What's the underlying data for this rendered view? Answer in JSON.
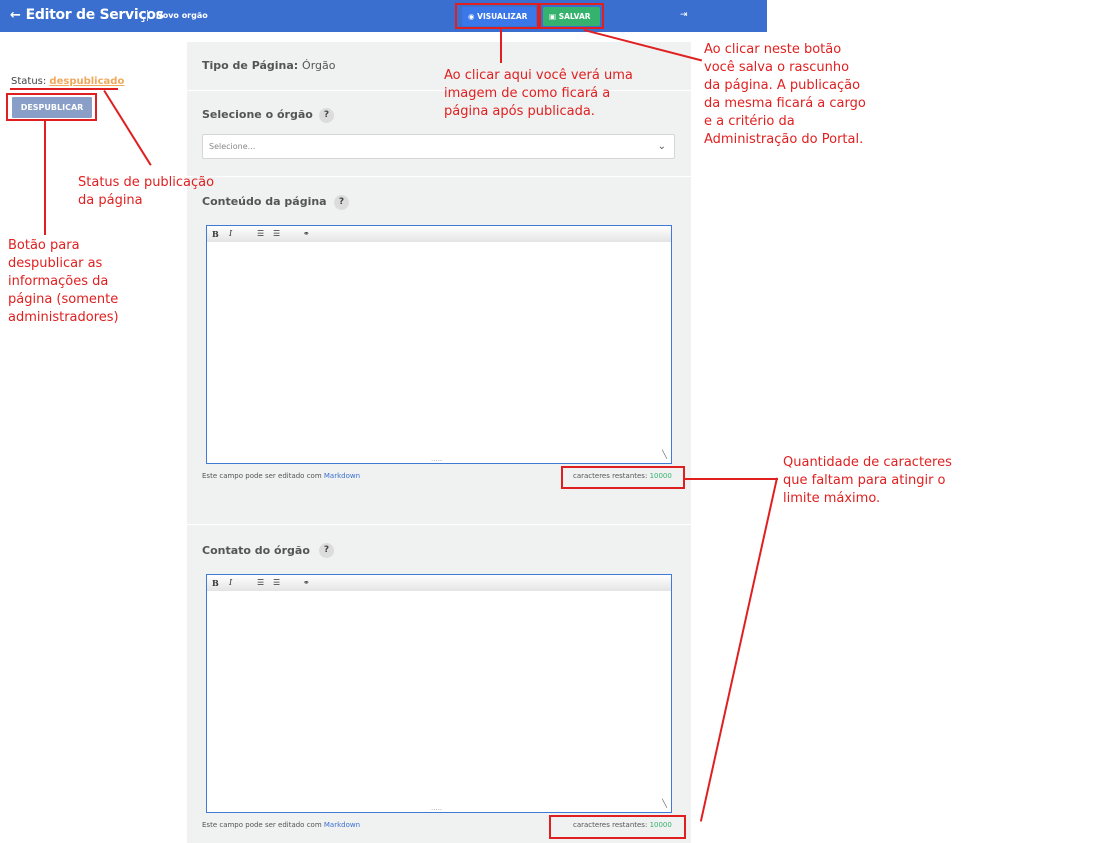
{
  "topbar": {
    "back_arrow": "🡐",
    "title": "Editor de Serviços",
    "breadcrumb": "Novo orgão",
    "visualize_label": "VISUALIZAR",
    "save_label": "SALVAR",
    "exit_icon": "sign-out-icon"
  },
  "sidebar": {
    "status_label": "Status:",
    "status_value": "despublicado",
    "unpublish_label": "DESPUBLICAR"
  },
  "form": {
    "page_type_label": "Tipo de Página:",
    "page_type_value": "Órgão",
    "organ_label": "Selecione o órgão",
    "organ_placeholder": "Selecione...",
    "content_label": "Conteúdo da página",
    "contact_label": "Contato do órgão",
    "help_symbol": "?",
    "markdown_prefix": "Este campo pode ser editado com",
    "markdown_link": "Markdown",
    "chars_label": "caracteres restantes:",
    "chars_value": "10000"
  },
  "toolbar": {
    "bold": "B",
    "italic": "I",
    "ul": "☰",
    "ol": "☰",
    "link": "⚭"
  },
  "annotations": {
    "visualize": "Ao clicar aqui você verá uma imagem de como ficará a página após publicada.",
    "save": "Ao clicar neste botão você salva o rascunho da página. A publicação da mesma ficará a cargo e a critério da Administração do Portal.",
    "status": "Status de publicação da página",
    "unpublish": "Botão para despublicar as informações da página (somente administradores)",
    "counter": "Quantidade de caracteres que faltam para atingir o limite máximo."
  },
  "colors": {
    "topbar": "#3a6fd0",
    "save": "#35b26e",
    "annotation": "#e02020",
    "status_value": "#f0a85a"
  }
}
